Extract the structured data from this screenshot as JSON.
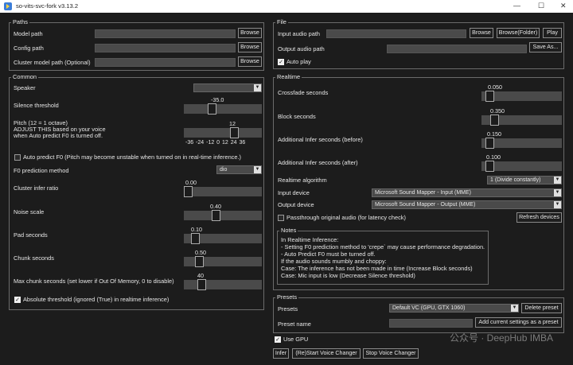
{
  "window": {
    "title": "so-vits-svc-fork v3.13.2",
    "min": "—",
    "max": "☐",
    "close": "✕"
  },
  "paths": {
    "frame_label": "Paths",
    "model_path": "Model path",
    "config_path": "Config path",
    "cluster_model_path": "Cluster model path (Optional)",
    "browse": "Browse"
  },
  "common": {
    "frame_label": "Common",
    "speaker": "Speaker",
    "silence_threshold": {
      "label": "Silence threshold",
      "value": "-35.0",
      "fraction": 0.35
    },
    "pitch": {
      "label_line1": "Pitch (12 = 1 octave)",
      "label_line2": "ADJUST THIS based on your voice",
      "label_line3": "when Auto predict F0 is turned off.",
      "value": "12",
      "fraction": 0.67,
      "ticks": "-36 -24 -12   0   12  24  36"
    },
    "auto_predict_f0": "Auto predict F0 (Pitch may become unstable when turned on in real-time inference.)",
    "f0_method": {
      "label": "F0 prediction method",
      "value": "dio"
    },
    "cluster_infer_ratio": {
      "label": "Cluster infer ratio",
      "value": "0.00",
      "fraction": 0.0
    },
    "noise_scale": {
      "label": "Noise scale",
      "value": "0.40",
      "fraction": 0.4
    },
    "pad_seconds": {
      "label": "Pad seconds",
      "value": "0.10",
      "fraction": 0.1
    },
    "chunk_seconds": {
      "label": "Chunk seconds",
      "value": "0.50",
      "fraction": 0.16
    },
    "max_chunk_seconds": {
      "label": "Max chunk seconds (set lower if Out Of Memory, 0 to disable)",
      "value": "40",
      "fraction": 0.2
    },
    "absolute_threshold": "Absolute threshold (ignored (True) in realtime inference)"
  },
  "file": {
    "frame_label": "File",
    "input_audio_path": "Input audio path",
    "output_audio_path": "Output audio path",
    "browse": "Browse",
    "browse_folder": "Browse(Folder)",
    "play": "Play",
    "save_as": "Save As...",
    "auto_play": "Auto play"
  },
  "realtime": {
    "frame_label": "Realtime",
    "crossfade": {
      "label": "Crossfade seconds",
      "value": "0.050",
      "fraction": 0.05
    },
    "block": {
      "label": "Block seconds",
      "value": "0.350",
      "fraction": 0.12
    },
    "infer_before": {
      "label": "Additional Infer seconds (before)",
      "value": "0.150",
      "fraction": 0.06
    },
    "infer_after": {
      "label": "Additional Infer seconds (after)",
      "value": "0.100",
      "fraction": 0.05
    },
    "algorithm": {
      "label": "Realtime algorithm",
      "value": "1 (Divide constantly)"
    },
    "input_device": {
      "label": "Input device",
      "value": "Microsoft Sound Mapper - Input (MME)"
    },
    "output_device": {
      "label": "Output device",
      "value": "Microsoft Sound Mapper - Output (MME)"
    },
    "passthrough": "Passthrough original audio (for latency check)",
    "refresh_devices": "Refresh devices"
  },
  "notes": {
    "frame_label": "Notes",
    "lines": [
      "In Realtime Inference:",
      "    - Setting F0 prediction method to 'crepe` may cause performance degradation.",
      "    - Auto Predict F0 must be turned off.",
      "If the audio sounds mumbly and choppy:",
      "    Case: The inference has not been made in time (Increase Block seconds)",
      "    Case: Mic input is low (Decrease Silence threshold)"
    ]
  },
  "presets": {
    "frame_label": "Presets",
    "label": "Presets",
    "value": "Default VC (GPU, GTX 1060)",
    "delete": "Delete preset",
    "name_label": "Preset name",
    "add": "Add current settings as a preset"
  },
  "bottom": {
    "use_gpu": "Use GPU",
    "infer": "Infer",
    "restart": "(Re)Start Voice Changer",
    "stop": "Stop Voice Changer"
  },
  "watermark": "公众号 · DeepHub IMBA"
}
